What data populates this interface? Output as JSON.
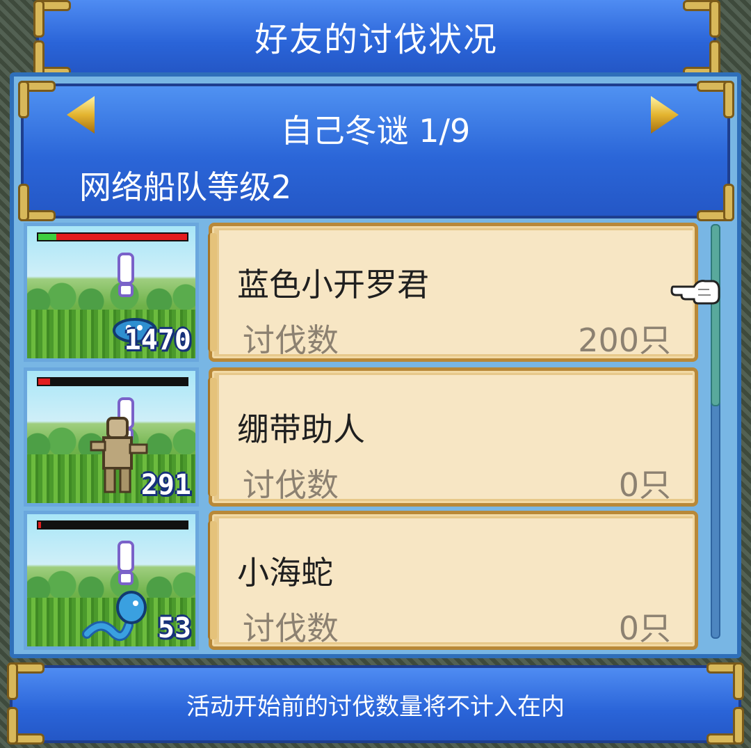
{
  "title": "好友的讨伐状况",
  "header": {
    "filter_title": "自己冬谜 1/9",
    "fleet_level": "网络船队等级2"
  },
  "monsters": [
    {
      "name": "蓝色小开罗君",
      "count_label": "讨伐数",
      "count_value": "200只",
      "badge": "1470",
      "hp_fraction": 0.12,
      "bar_color": "#e21d1d"
    },
    {
      "name": "绷带助人",
      "count_label": "讨伐数",
      "count_value": "0只",
      "badge": "291",
      "hp_fraction": 0.08,
      "bar_color": "#111111"
    },
    {
      "name": "小海蛇",
      "count_label": "讨伐数",
      "count_value": "0只",
      "badge": "53",
      "hp_fraction": 0.02,
      "bar_color": "#111111"
    }
  ],
  "footer": {
    "note": "活动开始前的讨伐数量将不计入在内"
  },
  "icons": {
    "prev": "arrow-left-icon",
    "next": "arrow-right-icon",
    "pointer": "hand-pointer-icon"
  },
  "colors": {
    "panel_blue": "#2a64d8",
    "scroll_paper": "#f7e6c4",
    "hp_green": "#3ecf3e",
    "hp_red": "#e21d1d"
  }
}
